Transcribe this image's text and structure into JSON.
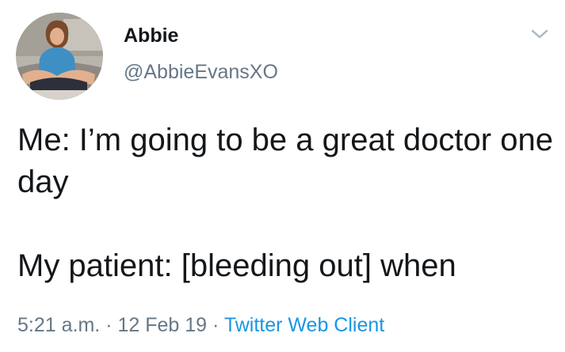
{
  "tweet": {
    "author": {
      "display_name": "Abbie",
      "handle": "@AbbieEvansXO",
      "avatar_icon": "profile-photo"
    },
    "menu_icon": "chevron-down-icon",
    "text": {
      "line1": "Me: I’m going to be a great doctor one day",
      "line2": "My patient: [bleeding out] when"
    },
    "meta": {
      "time": "5:21 a.m.",
      "separator": "·",
      "date": "12 Feb 19",
      "source": "Twitter Web Client"
    },
    "colors": {
      "text": "#14171a",
      "secondary": "#657786",
      "link": "#1b95e0"
    }
  }
}
